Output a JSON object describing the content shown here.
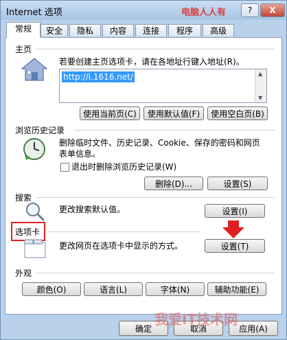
{
  "window": {
    "title": "Internet 选项",
    "watermark_top": "电脑人人有",
    "help_label": "?",
    "close_label": "X"
  },
  "tabs": [
    "常规",
    "安全",
    "隐私",
    "内容",
    "连接",
    "程序",
    "高级"
  ],
  "home": {
    "section_title": "主页",
    "instruction": "若要创建主页选项卡，请在各地址行键入地址(R)。",
    "url": "http://i.1616.net/",
    "buttons": [
      "使用当前页(C)",
      "使用默认值(F)",
      "使用空白页(B)"
    ]
  },
  "history": {
    "section_title": "浏览历史记录",
    "description": "删除临时文件、历史记录、Cookie、保存的密码和网页表单信息。",
    "checkbox_label": "退出时删除浏览历史记录(W)",
    "delete_label": "删除(D)...",
    "settings_label": "设置(S)"
  },
  "search": {
    "section_title": "搜索",
    "description": "更改搜索默认值。",
    "settings_label": "设置(I)"
  },
  "tabs_section": {
    "section_title": "选项卡",
    "description": "更改网页在选项卡中显示的方式。",
    "settings_label": "设置(T)"
  },
  "appearance": {
    "section_title": "外观",
    "buttons": [
      "颜色(O)",
      "语言(L)",
      "字体(N)",
      "辅助功能(E)"
    ]
  },
  "footer": {
    "ok_label": "确定",
    "cancel_label": "取消",
    "apply_label": "应用(A)",
    "watermark": "我爱IT技术网"
  }
}
